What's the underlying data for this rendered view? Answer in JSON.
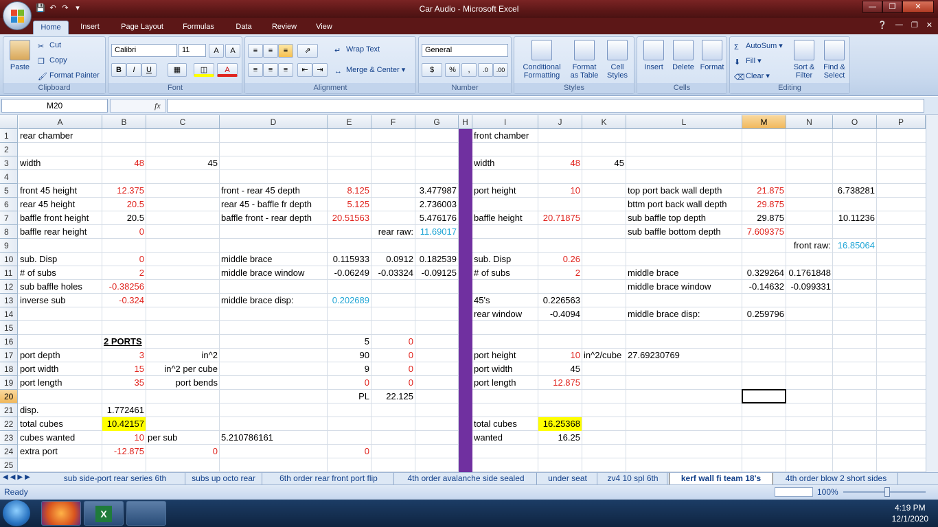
{
  "window": {
    "title": "Car Audio - Microsoft Excel"
  },
  "tabs": [
    "Home",
    "Insert",
    "Page Layout",
    "Formulas",
    "Data",
    "Review",
    "View"
  ],
  "ribbon": {
    "clipboard": {
      "label": "Clipboard",
      "paste": "Paste",
      "cut": "Cut",
      "copy": "Copy",
      "format_painter": "Format Painter"
    },
    "font": {
      "label": "Font",
      "name": "Calibri",
      "size": "11"
    },
    "alignment": {
      "label": "Alignment",
      "wrap": "Wrap Text",
      "merge": "Merge & Center"
    },
    "number": {
      "label": "Number",
      "format": "General"
    },
    "styles": {
      "label": "Styles",
      "conditional": "Conditional",
      "conditional2": "Formatting",
      "format_table": "Format",
      "format_table2": "as Table",
      "cell_styles": "Cell",
      "cell_styles2": "Styles"
    },
    "cells": {
      "label": "Cells",
      "insert": "Insert",
      "delete": "Delete",
      "format": "Format"
    },
    "editing": {
      "label": "Editing",
      "autosum": "AutoSum",
      "fill": "Fill",
      "clear": "Clear",
      "sort": "Sort &",
      "sort2": "Filter",
      "find": "Find &",
      "find2": "Select"
    }
  },
  "formula_bar": {
    "name_box": "M20",
    "fx": "fx",
    "formula": ""
  },
  "columns": [
    "A",
    "B",
    "C",
    "D",
    "E",
    "F",
    "G",
    "H",
    "I",
    "J",
    "K",
    "L",
    "M",
    "N",
    "O",
    "P"
  ],
  "rows": [
    "1",
    "2",
    "3",
    "4",
    "5",
    "6",
    "7",
    "8",
    "9",
    "10",
    "11",
    "12",
    "13",
    "14",
    "15",
    "16",
    "17",
    "18",
    "19",
    "20",
    "21",
    "22",
    "23",
    "24",
    "25"
  ],
  "cells": {
    "A1": "rear chamber",
    "I1": "front chamber",
    "A3": "width",
    "B3": "48",
    "C3": "45",
    "I3": "width",
    "J3": "48",
    "K3": "45",
    "A5": "front 45 height",
    "B5": "12.375",
    "D5": "front - rear 45 depth",
    "E5": "8.125",
    "G5": "3.477987",
    "I5": "port height",
    "J5": "10",
    "L5": "top port back wall depth",
    "M5": "21.875",
    "O5": "6.738281",
    "A6": "rear 45 height",
    "B6": "20.5",
    "D6": "rear 45 - baffle fr depth",
    "E6": "5.125",
    "G6": "2.736003",
    "L6": "bttm port back wall depth",
    "M6": "29.875",
    "A7": "baffle front height",
    "B7": "20.5",
    "D7": "baffle front - rear depth",
    "E7": "20.51563",
    "G7": "5.476176",
    "I7": "baffle height",
    "J7": "20.71875",
    "L7": "sub baffle top depth",
    "M7": "29.875",
    "O7": "10.11236",
    "A8": "baffle rear height",
    "B8": "0",
    "F8": "rear raw:",
    "G8": "11.69017",
    "L8": "sub baffle bottom depth",
    "M8": "7.609375",
    "N9": "front raw:",
    "O9": "16.85064",
    "A10": "sub. Disp",
    "B10": "0",
    "D10": "middle brace",
    "E10": "0.115933",
    "F10": "0.0912",
    "G10": "0.182539",
    "I10": "sub. Disp",
    "J10": "0.26",
    "A11": "# of subs",
    "B11": "2",
    "D11": "middle brace window",
    "E11": "-0.06249",
    "F11": "-0.03324",
    "G11": "-0.09125",
    "I11": "# of subs",
    "J11": "2",
    "L11": "middle brace",
    "M11": "0.329264",
    "N11": "0.1761848",
    "A12": "sub baffle holes",
    "B12": "-0.38256",
    "L12": "middle brace window",
    "M12": "-0.14632",
    "N12": "-0.099331",
    "A13": "inverse sub",
    "B13": "-0.324",
    "D13": "middle brace disp:",
    "E13": "0.202689",
    "I13": "45's",
    "J13": "0.226563",
    "I14": "rear window",
    "J14": "-0.4094",
    "L14": "middle brace disp:",
    "M14": "0.259796",
    "B16": "2 PORTS",
    "E16": "5",
    "F16": "0",
    "A17": "port depth",
    "B17": "3",
    "C17": "in^2",
    "E17": "90",
    "F17": "0",
    "I17": "port height",
    "J17": "10",
    "K17": "in^2/cube",
    "L17": "27.69230769",
    "A18": "port width",
    "B18": "15",
    "C18": "in^2 per cube",
    "E18": "9",
    "F18": "0",
    "I18": "port width",
    "J18": "45",
    "A19": "port length",
    "B19": "35",
    "C19": "port bends",
    "E19": "0",
    "F19": "0",
    "I19": "port length",
    "J19": "12.875",
    "E20": "PL",
    "F20": "22.125",
    "A21": "disp.",
    "B21": "1.772461",
    "A22": "total cubes",
    "B22": "10.42157",
    "I22": "total cubes",
    "J22": "16.25368",
    "A23": "cubes wanted",
    "B23": "10",
    "C23": "per sub",
    "D23": "5.210786161",
    "I23": "wanted",
    "J23": "16.25",
    "A24": "extra port",
    "B24": "-12.875",
    "C24": "0",
    "E24": "0"
  },
  "cell_colors": {
    "red": "#e0241e",
    "blue": "#21a6d6",
    "highlight": "#ffff00",
    "divider": "#7030a0"
  },
  "sheets": [
    "sub side-port rear series 6th",
    "subs up octo rear",
    "6th order rear front port flip",
    "4th order avalanche side sealed",
    "under seat",
    "zv4 10 spl 6th",
    "kerf wall fi team 18's",
    "4th order blow 2 short sides"
  ],
  "active_sheet": "kerf wall fi team 18's",
  "status": {
    "ready": "Ready",
    "zoom": "100%"
  },
  "clock": {
    "time": "4:19 PM",
    "date": "12/1/2020"
  }
}
